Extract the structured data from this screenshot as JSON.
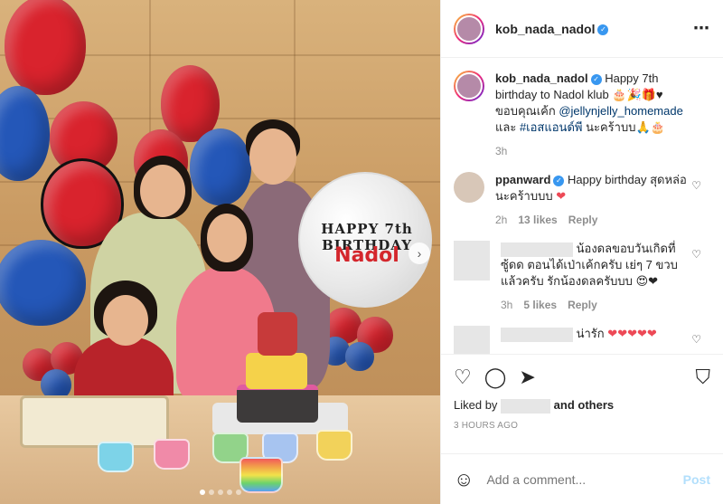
{
  "post": {
    "header": {
      "username": "kob_nada_nadol",
      "more_icon": "⋯"
    },
    "photo": {
      "balloon_text_line1": "HAPPY 7th BIRTHDAY",
      "balloon_text_line2": "Nadol",
      "next_icon": "›",
      "carousel_dots": 5,
      "active_dot": 0
    },
    "caption": {
      "username": "kob_nada_nadol",
      "text_1": "Happy 7th birthday to Nadol klub 🎂🎉🎁♥",
      "text_2": "ขอบคุณเค้ก",
      "mention": "@jellynjelly_homemade",
      "text_3": "และ",
      "hashtag": "#เอสแอนด์พี",
      "text_4": "นะคร้าบบ🙏🎂",
      "time": "3h"
    },
    "comments": [
      {
        "username": "ppanward",
        "text": "Happy birthday สุดหล่อนะคร้าบบบ",
        "emoji": "❤",
        "time": "2h",
        "likes": "13 likes",
        "reply": "Reply"
      },
      {
        "username": "",
        "text": "น้องดลขอบวันเกิดที่ ซู้ดด ตอนได้เป่าเค้กครับ เย่ๆ 7 ขวบ แล้วครับ รักน้องดลครับบบ",
        "emoji": "😍❤",
        "time": "3h",
        "likes": "5 likes",
        "reply": "Reply"
      },
      {
        "username": "",
        "text": "น่ารัก",
        "emoji": "❤❤❤❤❤",
        "time": "",
        "likes": "",
        "reply": ""
      }
    ],
    "actions": {
      "like_icon": "♡",
      "comment_icon": "◯",
      "share_icon": "➤",
      "bookmark_icon": "⛉",
      "liked_by_prefix": "Liked by",
      "liked_by_suffix": "and others",
      "time_ago": "3 HOURS AGO"
    },
    "add_comment": {
      "emoji_icon": "☺",
      "placeholder": "Add a comment...",
      "post_label": "Post"
    }
  }
}
